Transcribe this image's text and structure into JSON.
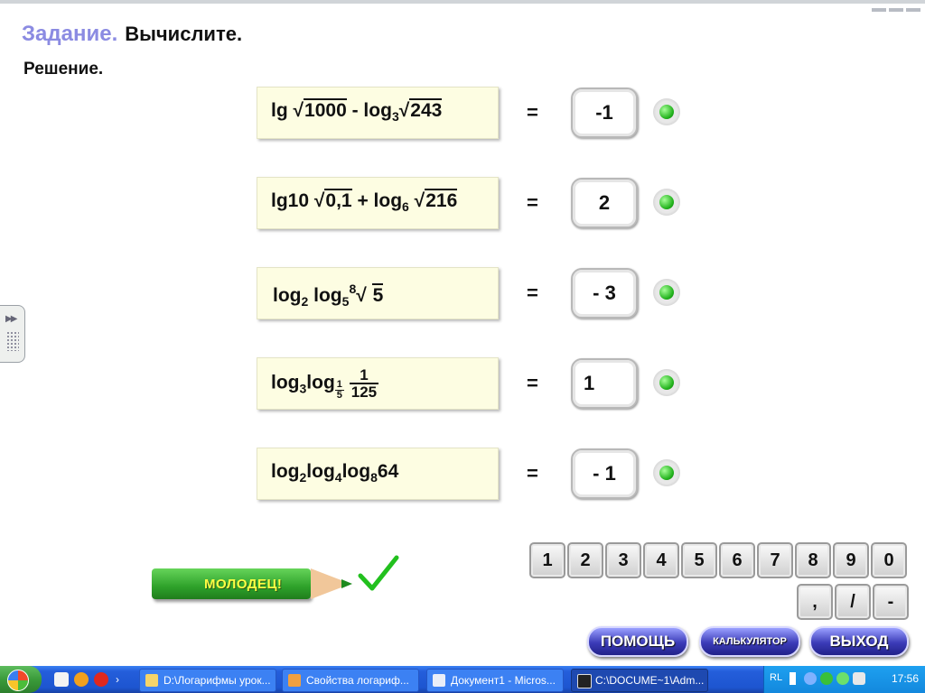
{
  "header": {
    "title_label": "Задание.",
    "task_text": "Вычислите."
  },
  "solution_label": "Решение.",
  "problems": [
    {
      "parts": [
        "lg",
        "1000",
        "- log",
        "3",
        "243"
      ],
      "equals": "=",
      "answer": "-1"
    },
    {
      "parts": [
        "lg10",
        "0,1",
        "+ log",
        "6",
        "216"
      ],
      "equals": "=",
      "answer": "2"
    },
    {
      "parts": [
        "log",
        "2",
        "log",
        "5",
        "8",
        "5"
      ],
      "equals": "=",
      "answer": "- 3"
    },
    {
      "parts": [
        "log",
        "3",
        "log",
        "1",
        "5",
        "1",
        "125"
      ],
      "equals": "=",
      "answer": "1"
    },
    {
      "parts": [
        "log",
        "2",
        "log",
        "4",
        "log",
        "8",
        "64"
      ],
      "equals": "=",
      "answer": "- 1"
    }
  ],
  "status_led_color": "#22b21c",
  "pencil_label": "МОЛОДЕЦ!",
  "keypad": {
    "digits": [
      "1",
      "2",
      "3",
      "4",
      "5",
      "6",
      "7",
      "8",
      "9",
      "0"
    ],
    "symbols": [
      ",",
      "/",
      "-"
    ]
  },
  "controls": {
    "help": "ПОМОЩЬ",
    "calculator": "КАЛЬКУЛЯТОР",
    "exit": "ВЫХОД"
  },
  "taskbar": {
    "items": [
      "D:\\Логарифмы урок...",
      "Свойства логариф...",
      "Документ1 - Micros...",
      "C:\\DOCUME~1\\Adm..."
    ],
    "language": "RL",
    "clock": "17:56"
  }
}
